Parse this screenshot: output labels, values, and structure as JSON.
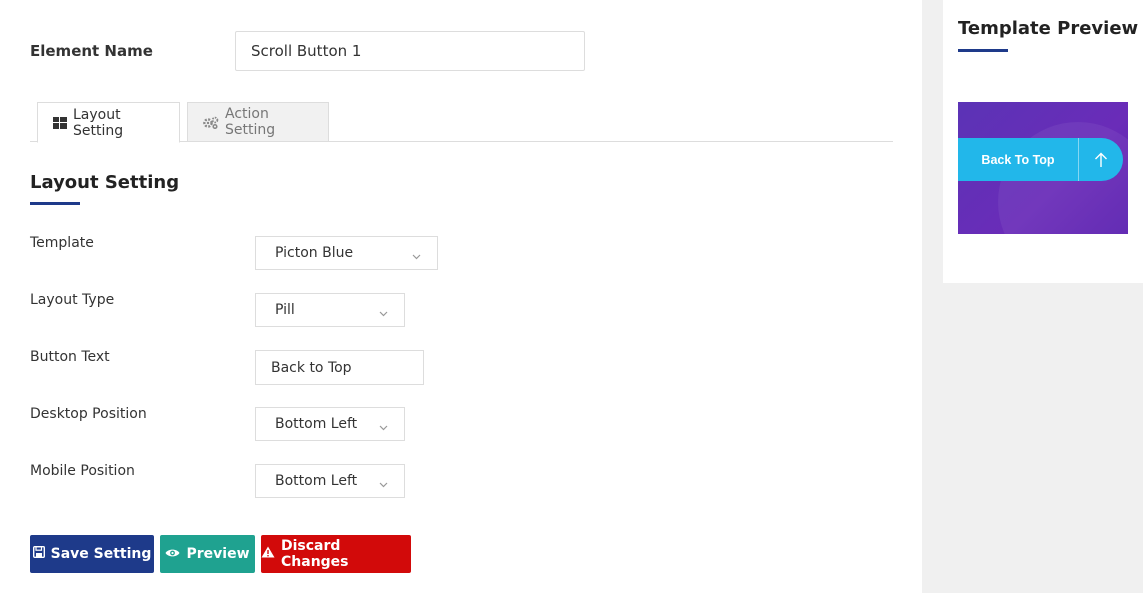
{
  "element_name": {
    "label": "Element Name",
    "value": "Scroll Button 1"
  },
  "tabs": [
    {
      "label": "Layout Setting",
      "icon": "grid-icon",
      "active": true
    },
    {
      "label": "Action Setting",
      "icon": "gears-icon",
      "active": false
    }
  ],
  "section": {
    "title": "Layout Setting"
  },
  "fields": {
    "template": {
      "label": "Template",
      "value": "Picton Blue"
    },
    "layout_type": {
      "label": "Layout Type",
      "value": "Pill"
    },
    "button_text": {
      "label": "Button Text",
      "value": "Back to Top"
    },
    "desktop_position": {
      "label": "Desktop Position",
      "value": "Bottom Left"
    },
    "mobile_position": {
      "label": "Mobile Position",
      "value": "Bottom Left"
    }
  },
  "buttons": {
    "save": "Save Setting",
    "preview": "Preview",
    "discard": "Discard Changes"
  },
  "template_preview": {
    "title": "Template Preview",
    "button_label": "Back To Top"
  },
  "colors": {
    "primary": "#1e3a8a",
    "preview": "#1fa290",
    "danger": "#d20a0a",
    "pill": "#22b7ea",
    "preview_bg": "#5b33b6"
  }
}
